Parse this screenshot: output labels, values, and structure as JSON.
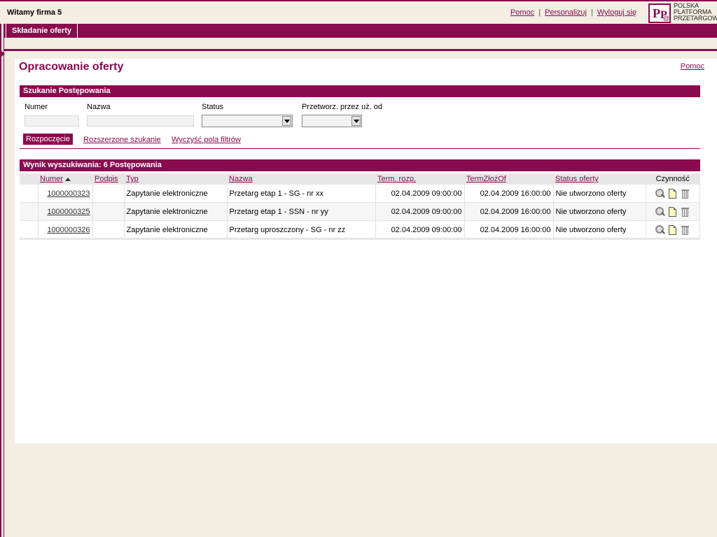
{
  "header": {
    "welcome": "Witamy firma 5",
    "links": [
      "Pomoc",
      "Personalizuj",
      "Wyloguj się"
    ],
    "logo_lines": [
      "POLSKA",
      "PLATFORMA",
      "PRZETARGOWA"
    ]
  },
  "nav": {
    "active_tab": "Składanie oferty"
  },
  "page": {
    "title": "Opracowanie oferty",
    "help": "Pomoc"
  },
  "search": {
    "section_title": "Szukanie Postępowania",
    "labels": {
      "numer": "Numer",
      "nazwa": "Nazwa",
      "status": "Status",
      "przetworz": "Przetworz. przez uż. od"
    },
    "values": {
      "numer": "",
      "nazwa": "",
      "status": "",
      "przetworz": ""
    },
    "start_button": "Rozpoczęcie",
    "advanced_link": "Rozszerzone szukanie",
    "clear_link": "Wyczyść pola filtrów"
  },
  "results": {
    "section_title": "Wynik wyszukiwania:  6 Postępowania",
    "columns": [
      "Numer",
      "Podpis",
      "Typ",
      "Nazwa",
      "Term. rozp.",
      "TermZłożOf",
      "Status oferty",
      "Czynność"
    ],
    "rows": [
      {
        "numer": "1000000323",
        "podpis": "",
        "typ": "Zapytanie elektroniczne",
        "nazwa": "Przetarg etap 1 - SG - nr xx",
        "term_rozp": "02.04.2009 09:00:00",
        "term_zloz": "02.04.2009 16:00:00",
        "status": "Nie utworzono oferty"
      },
      {
        "numer": "1000000325",
        "podpis": "",
        "typ": "Zapytanie elektroniczne",
        "nazwa": "Przetarg etap 1 - SSN - nr yy",
        "term_rozp": "02.04.2009 09:00:00",
        "term_zloz": "02.04.2009 16:00:00",
        "status": "Nie utworzono oferty"
      },
      {
        "numer": "1000000326",
        "podpis": "",
        "typ": "Zapytanie elektroniczne",
        "nazwa": "Przetarg uproszczony - SG - nr zz",
        "term_rozp": "02.04.2009 09:00:00",
        "term_zloz": "02.04.2009 16:00:00",
        "status": "Nie utworzono oferty"
      }
    ],
    "row_actions": [
      "search-icon",
      "document-icon",
      "trash-icon"
    ]
  },
  "colors": {
    "brand": "#8a0a4e",
    "background": "#f3ede2"
  }
}
